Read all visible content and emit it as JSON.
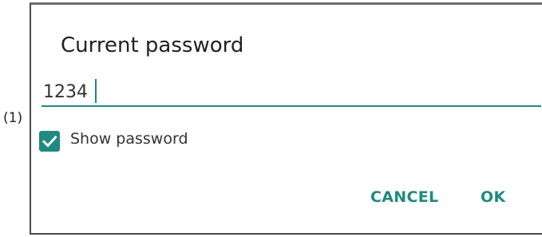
{
  "callout": {
    "label": "(1)"
  },
  "dialog": {
    "title": "Current password",
    "password_value": "1234",
    "show_password": {
      "label": "Show password",
      "checked": true
    },
    "buttons": {
      "cancel_label": "CANCEL",
      "ok_label": "OK"
    }
  },
  "colors": {
    "accent": "#1f8a80",
    "title_text": "#212121",
    "body_text": "#333333"
  },
  "icons": {
    "checkbox": "checkmark-icon"
  }
}
